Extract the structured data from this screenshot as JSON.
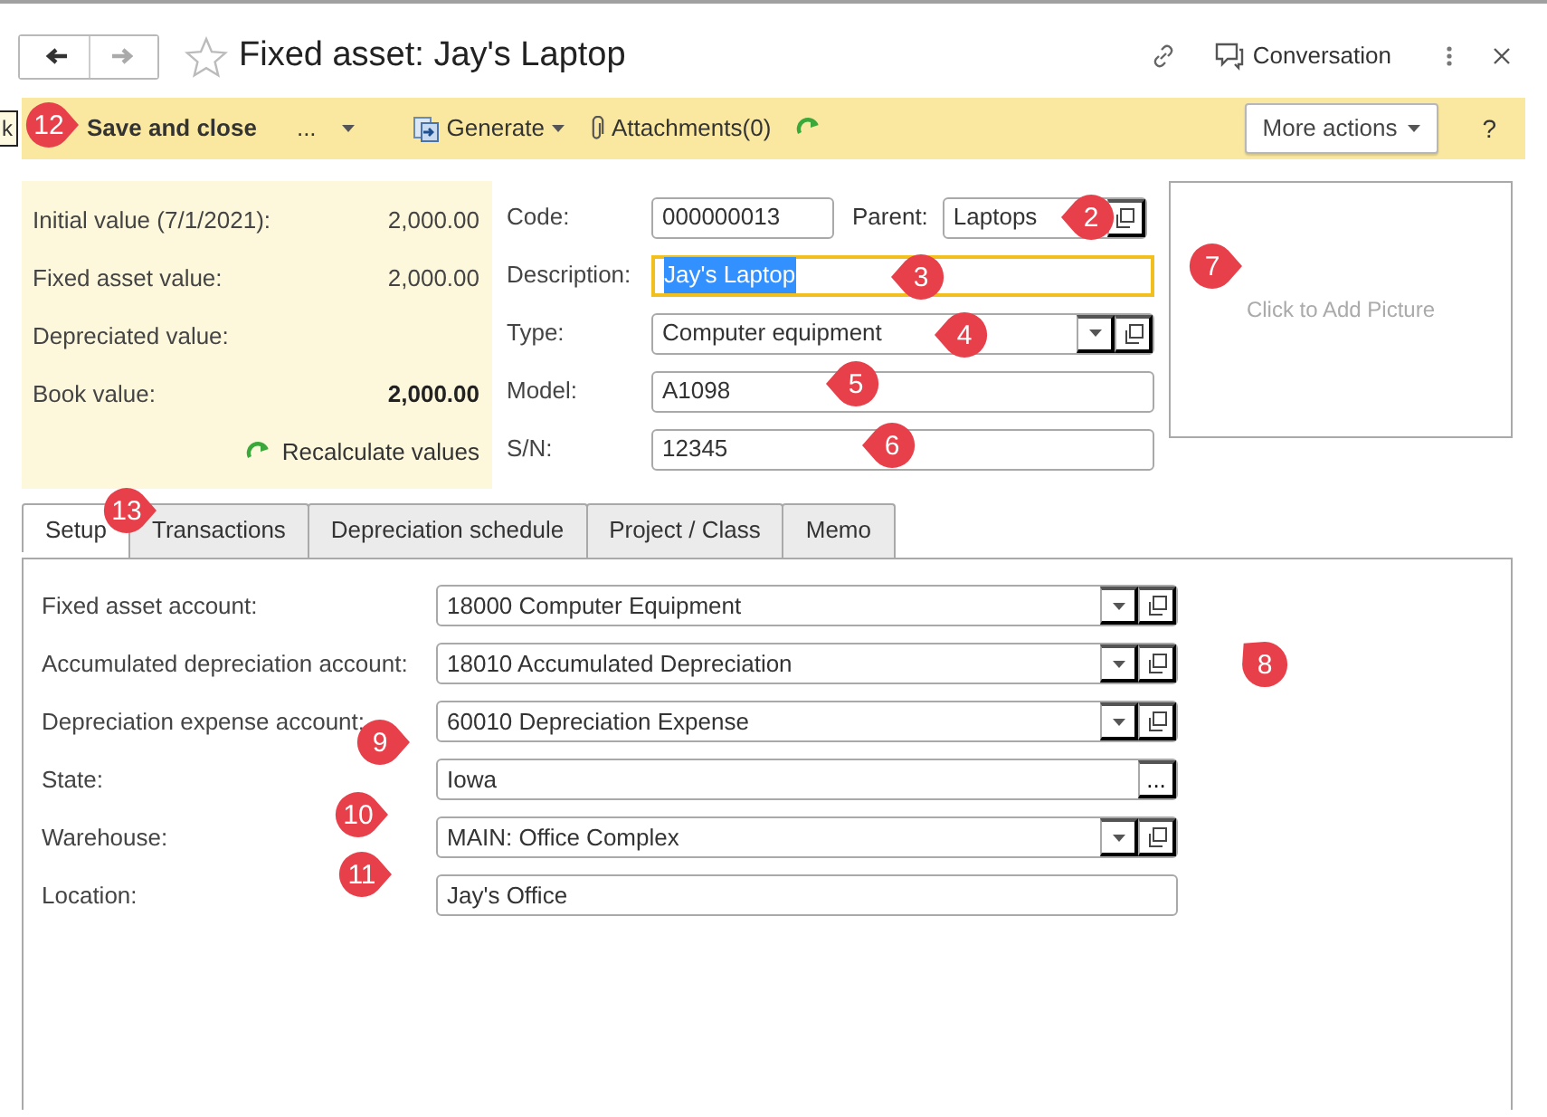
{
  "nav": [
    {
      "kind": "back",
      "disabled": false
    },
    {
      "kind": "forward",
      "disabled": true
    }
  ],
  "title": "Fixed asset: Jay's Laptop",
  "favorite": false,
  "header_actions": {
    "conversation": "Conversation"
  },
  "toolbar": {
    "hidden_button": "k",
    "save": "Save and close",
    "more": "...",
    "generate": "Generate",
    "attachments": "Attachments(0)",
    "more_actions": "More actions",
    "help": "?"
  },
  "summary": {
    "rows": [
      {
        "label": "Initial value (7/1/2021):",
        "value": "2,000.00",
        "bold": false
      },
      {
        "label": "Fixed asset value:",
        "value": "2,000.00",
        "bold": false
      },
      {
        "label": "Depreciated value:"
      },
      {
        "label": "Book value:",
        "value": "2,000.00",
        "bold": true
      }
    ],
    "recalculate": "Recalculate values"
  },
  "details": {
    "code": {
      "label": "Code:",
      "value": "000000013",
      "focused": false
    },
    "parent": {
      "label": "Parent:",
      "value": "Laptops",
      "focused": false
    },
    "rows": [
      {
        "label": "Description:",
        "value": "Jay's Laptop",
        "kind": "text",
        "focused": true
      },
      {
        "label": "Type:",
        "value": "Computer equipment",
        "kind": "select",
        "focused": false
      },
      {
        "label": "Model:",
        "value": "A1098",
        "kind": "text",
        "focused": false
      },
      {
        "label": "S/N:",
        "value": "12345",
        "kind": "text",
        "focused": false
      }
    ]
  },
  "picture": {
    "placeholder": "Click to Add Picture"
  },
  "tabs": [
    {
      "label": "Setup",
      "selected": true
    },
    {
      "label": "Transactions",
      "selected": false
    },
    {
      "label": "Depreciation schedule",
      "selected": false
    },
    {
      "label": "Project / Class",
      "selected": false
    },
    {
      "label": "Memo",
      "selected": false
    }
  ],
  "setup_fields": [
    {
      "label": "Fixed asset account:",
      "value": "18000 Computer Equipment",
      "kind": "select"
    },
    {
      "label": "Accumulated depreciation account:",
      "value": "18010 Accumulated Depreciation",
      "kind": "select"
    },
    {
      "label": "Depreciation expense account:",
      "value": "60010 Depreciation Expense",
      "kind": "select"
    },
    {
      "label": "State:",
      "value": "Iowa",
      "kind": "choice",
      "button": "..."
    },
    {
      "label": "Warehouse:",
      "value": "MAIN: Office Complex",
      "kind": "select"
    },
    {
      "label": "Location:",
      "value": "Jay's Office",
      "kind": "text"
    }
  ],
  "callouts": [
    {
      "label": "2"
    },
    {
      "label": "3"
    },
    {
      "label": "4"
    },
    {
      "label": "5"
    },
    {
      "label": "6"
    },
    {
      "label": "7"
    },
    {
      "label": "8"
    },
    {
      "label": "9"
    },
    {
      "label": "10"
    },
    {
      "label": "11"
    },
    {
      "label": "12"
    },
    {
      "label": "13"
    }
  ]
}
